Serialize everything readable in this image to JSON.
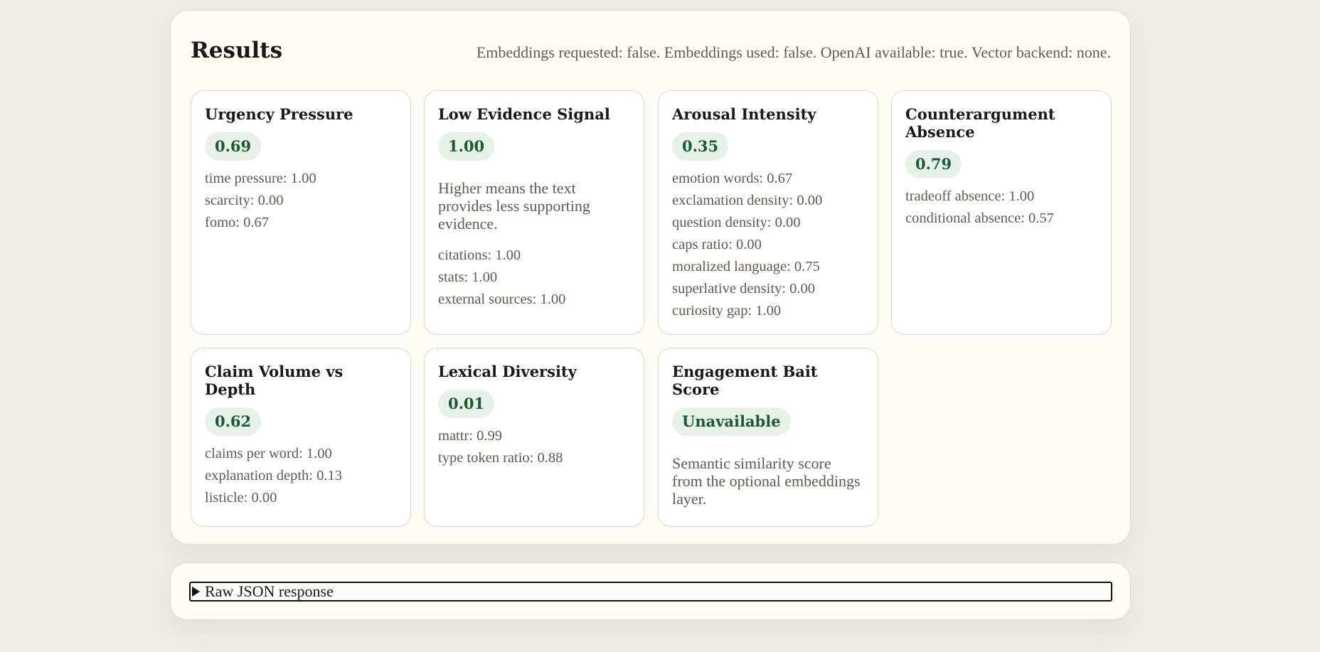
{
  "results": {
    "title": "Results",
    "meta": "Embeddings requested: false. Embeddings used: false. OpenAI available: true. Vector backend: none.",
    "cards": [
      {
        "title": "Urgency Pressure",
        "score": "0.69",
        "description": "",
        "metrics": [
          "time pressure: 1.00",
          "scarcity: 0.00",
          "fomo: 0.67"
        ]
      },
      {
        "title": "Low Evidence Signal",
        "score": "1.00",
        "description": "Higher means the text provides less supporting evidence.",
        "metrics": [
          "citations: 1.00",
          "stats: 1.00",
          "external sources: 1.00"
        ]
      },
      {
        "title": "Arousal Intensity",
        "score": "0.35",
        "description": "",
        "metrics": [
          "emotion words: 0.67",
          "exclamation density: 0.00",
          "question density: 0.00",
          "caps ratio: 0.00",
          "moralized language: 0.75",
          "superlative density: 0.00",
          "curiosity gap: 1.00"
        ]
      },
      {
        "title": "Counterargument Absence",
        "score": "0.79",
        "description": "",
        "metrics": [
          "tradeoff absence: 1.00",
          "conditional absence: 0.57"
        ]
      },
      {
        "title": "Claim Volume vs Depth",
        "score": "0.62",
        "description": "",
        "metrics": [
          "claims per word: 1.00",
          "explanation depth: 0.13",
          "listicle: 0.00"
        ]
      },
      {
        "title": "Lexical Diversity",
        "score": "0.01",
        "description": "",
        "metrics": [
          "mattr: 0.99",
          "type token ratio: 0.88"
        ]
      },
      {
        "title": "Engagement Bait Score",
        "score": "Unavailable",
        "description": "Semantic similarity score from the optional embeddings layer.",
        "metrics": []
      }
    ]
  },
  "raw_json": {
    "label": "Raw JSON response",
    "expanded": false
  },
  "colors": {
    "page_background": "#efede7",
    "panel_background": "#fdfcf7",
    "score_pill_background": "#e6f1e8",
    "score_text": "#1c5a34"
  },
  "icons": {
    "raw_json_toggle": "disclosure-triangle-right-icon"
  }
}
